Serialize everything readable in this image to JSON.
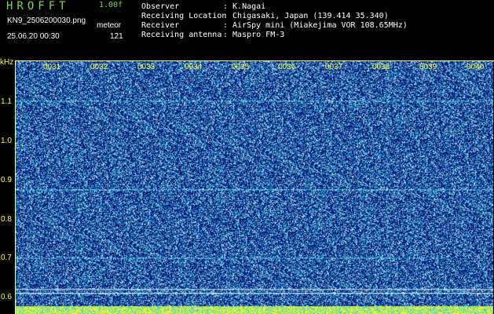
{
  "header": {
    "app_title": "HROFFT",
    "version": "1.00f",
    "filename": "KN9_2506200030.png",
    "datetime": "25.06.20 00:30",
    "mode": "meteor",
    "count": "121"
  },
  "info": [
    {
      "key": "Observer",
      "value": ": K.Nagai"
    },
    {
      "key": "Receiving Location",
      "value": ": Chigasaki, Japan (139.414 35.340)"
    },
    {
      "key": "Receiver",
      "value": ": AirSpy mini (Miakejima VOR 108.65MHz)"
    },
    {
      "key": "Receiving antenna",
      "value": ": Maspro FM-3"
    }
  ],
  "spectrogram": {
    "y_unit": "kHz",
    "y_ticks": [
      "1.1",
      "1.0",
      "0.9",
      "0.8",
      "0.7",
      "0.6"
    ],
    "x_ticks": [
      "0031",
      "0032",
      "0033",
      "0034",
      "0035",
      "0036",
      "0037",
      "0038",
      "0039",
      "0040"
    ],
    "colors": {
      "background": "#0a1a80",
      "axis": "#ffff3c",
      "title": "#7fd64a"
    }
  }
}
